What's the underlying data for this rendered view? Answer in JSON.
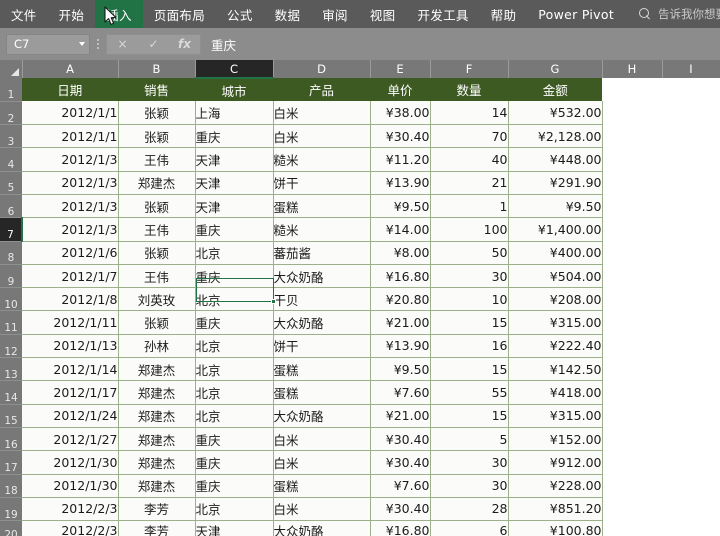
{
  "ribbon": {
    "tabs": [
      {
        "label": "文件",
        "active": false
      },
      {
        "label": "开始",
        "active": false
      },
      {
        "label": "插入",
        "active": true
      },
      {
        "label": "页面布局",
        "active": false
      },
      {
        "label": "公式",
        "active": false
      },
      {
        "label": "数据",
        "active": false
      },
      {
        "label": "审阅",
        "active": false
      },
      {
        "label": "视图",
        "active": false
      },
      {
        "label": "开发工具",
        "active": false
      },
      {
        "label": "帮助",
        "active": false
      },
      {
        "label": "Power Pivot",
        "active": false
      }
    ],
    "tell_me_placeholder": "告诉我你想要做什么",
    "active_tab_color": "#217346",
    "bar_color": "#5a5a5a"
  },
  "formula_bar": {
    "name_box_value": "C7",
    "cancel_icon": "×",
    "confirm_icon": "✓",
    "function_icon": "fx",
    "formula_value": "重庆"
  },
  "grid": {
    "columns": [
      "A",
      "B",
      "C",
      "D",
      "E",
      "F",
      "G",
      "H",
      "I"
    ],
    "selected_column": "C",
    "selected_row": "7",
    "selected_cell": "C7",
    "header_fill": "#3d5a22",
    "headers": [
      "日期",
      "销售",
      "城市",
      "产品",
      "单价",
      "数量",
      "金额"
    ],
    "row_numbers": [
      "1",
      "2",
      "3",
      "4",
      "5",
      "6",
      "7",
      "8",
      "9",
      "10",
      "11",
      "12",
      "13",
      "14",
      "15",
      "16",
      "17",
      "18",
      "19",
      "20"
    ],
    "rows": [
      {
        "row": "2",
        "date": "2012/1/1",
        "sales": "张颖",
        "city": "上海",
        "product": "白米",
        "price": "¥38.00",
        "qty": "14",
        "amount": "¥532.00"
      },
      {
        "row": "3",
        "date": "2012/1/1",
        "sales": "张颖",
        "city": "重庆",
        "product": "白米",
        "price": "¥30.40",
        "qty": "70",
        "amount": "¥2,128.00"
      },
      {
        "row": "4",
        "date": "2012/1/3",
        "sales": "王伟",
        "city": "天津",
        "product": "糙米",
        "price": "¥11.20",
        "qty": "40",
        "amount": "¥448.00"
      },
      {
        "row": "5",
        "date": "2012/1/3",
        "sales": "郑建杰",
        "city": "天津",
        "product": "饼干",
        "price": "¥13.90",
        "qty": "21",
        "amount": "¥291.90"
      },
      {
        "row": "6",
        "date": "2012/1/3",
        "sales": "张颖",
        "city": "天津",
        "product": "蛋糕",
        "price": "¥9.50",
        "qty": "1",
        "amount": "¥9.50"
      },
      {
        "row": "7",
        "date": "2012/1/3",
        "sales": "王伟",
        "city": "重庆",
        "product": "糙米",
        "price": "¥14.00",
        "qty": "100",
        "amount": "¥1,400.00"
      },
      {
        "row": "8",
        "date": "2012/1/6",
        "sales": "张颖",
        "city": "北京",
        "product": "蕃茄酱",
        "price": "¥8.00",
        "qty": "50",
        "amount": "¥400.00"
      },
      {
        "row": "9",
        "date": "2012/1/7",
        "sales": "王伟",
        "city": "重庆",
        "product": "大众奶酪",
        "price": "¥16.80",
        "qty": "30",
        "amount": "¥504.00"
      },
      {
        "row": "10",
        "date": "2012/1/8",
        "sales": "刘英玫",
        "city": "北京",
        "product": "干贝",
        "price": "¥20.80",
        "qty": "10",
        "amount": "¥208.00"
      },
      {
        "row": "11",
        "date": "2012/1/11",
        "sales": "张颖",
        "city": "重庆",
        "product": "大众奶酪",
        "price": "¥21.00",
        "qty": "15",
        "amount": "¥315.00"
      },
      {
        "row": "12",
        "date": "2012/1/13",
        "sales": "孙林",
        "city": "北京",
        "product": "饼干",
        "price": "¥13.90",
        "qty": "16",
        "amount": "¥222.40"
      },
      {
        "row": "13",
        "date": "2012/1/14",
        "sales": "郑建杰",
        "city": "北京",
        "product": "蛋糕",
        "price": "¥9.50",
        "qty": "15",
        "amount": "¥142.50"
      },
      {
        "row": "14",
        "date": "2012/1/17",
        "sales": "郑建杰",
        "city": "北京",
        "product": "蛋糕",
        "price": "¥7.60",
        "qty": "55",
        "amount": "¥418.00"
      },
      {
        "row": "15",
        "date": "2012/1/24",
        "sales": "郑建杰",
        "city": "北京",
        "product": "大众奶酪",
        "price": "¥21.00",
        "qty": "15",
        "amount": "¥315.00"
      },
      {
        "row": "16",
        "date": "2012/1/27",
        "sales": "郑建杰",
        "city": "重庆",
        "product": "白米",
        "price": "¥30.40",
        "qty": "5",
        "amount": "¥152.00"
      },
      {
        "row": "17",
        "date": "2012/1/30",
        "sales": "郑建杰",
        "city": "重庆",
        "product": "白米",
        "price": "¥30.40",
        "qty": "30",
        "amount": "¥912.00"
      },
      {
        "row": "18",
        "date": "2012/1/30",
        "sales": "郑建杰",
        "city": "重庆",
        "product": "蛋糕",
        "price": "¥7.60",
        "qty": "30",
        "amount": "¥228.00"
      },
      {
        "row": "19",
        "date": "2012/2/3",
        "sales": "李芳",
        "city": "北京",
        "product": "白米",
        "price": "¥30.40",
        "qty": "28",
        "amount": "¥851.20"
      },
      {
        "row": "20",
        "date": "2012/2/3",
        "sales": "李芳",
        "city": "天津",
        "product": "大众奶酪",
        "price": "¥16.80",
        "qty": "6",
        "amount": "¥100.80"
      }
    ]
  }
}
